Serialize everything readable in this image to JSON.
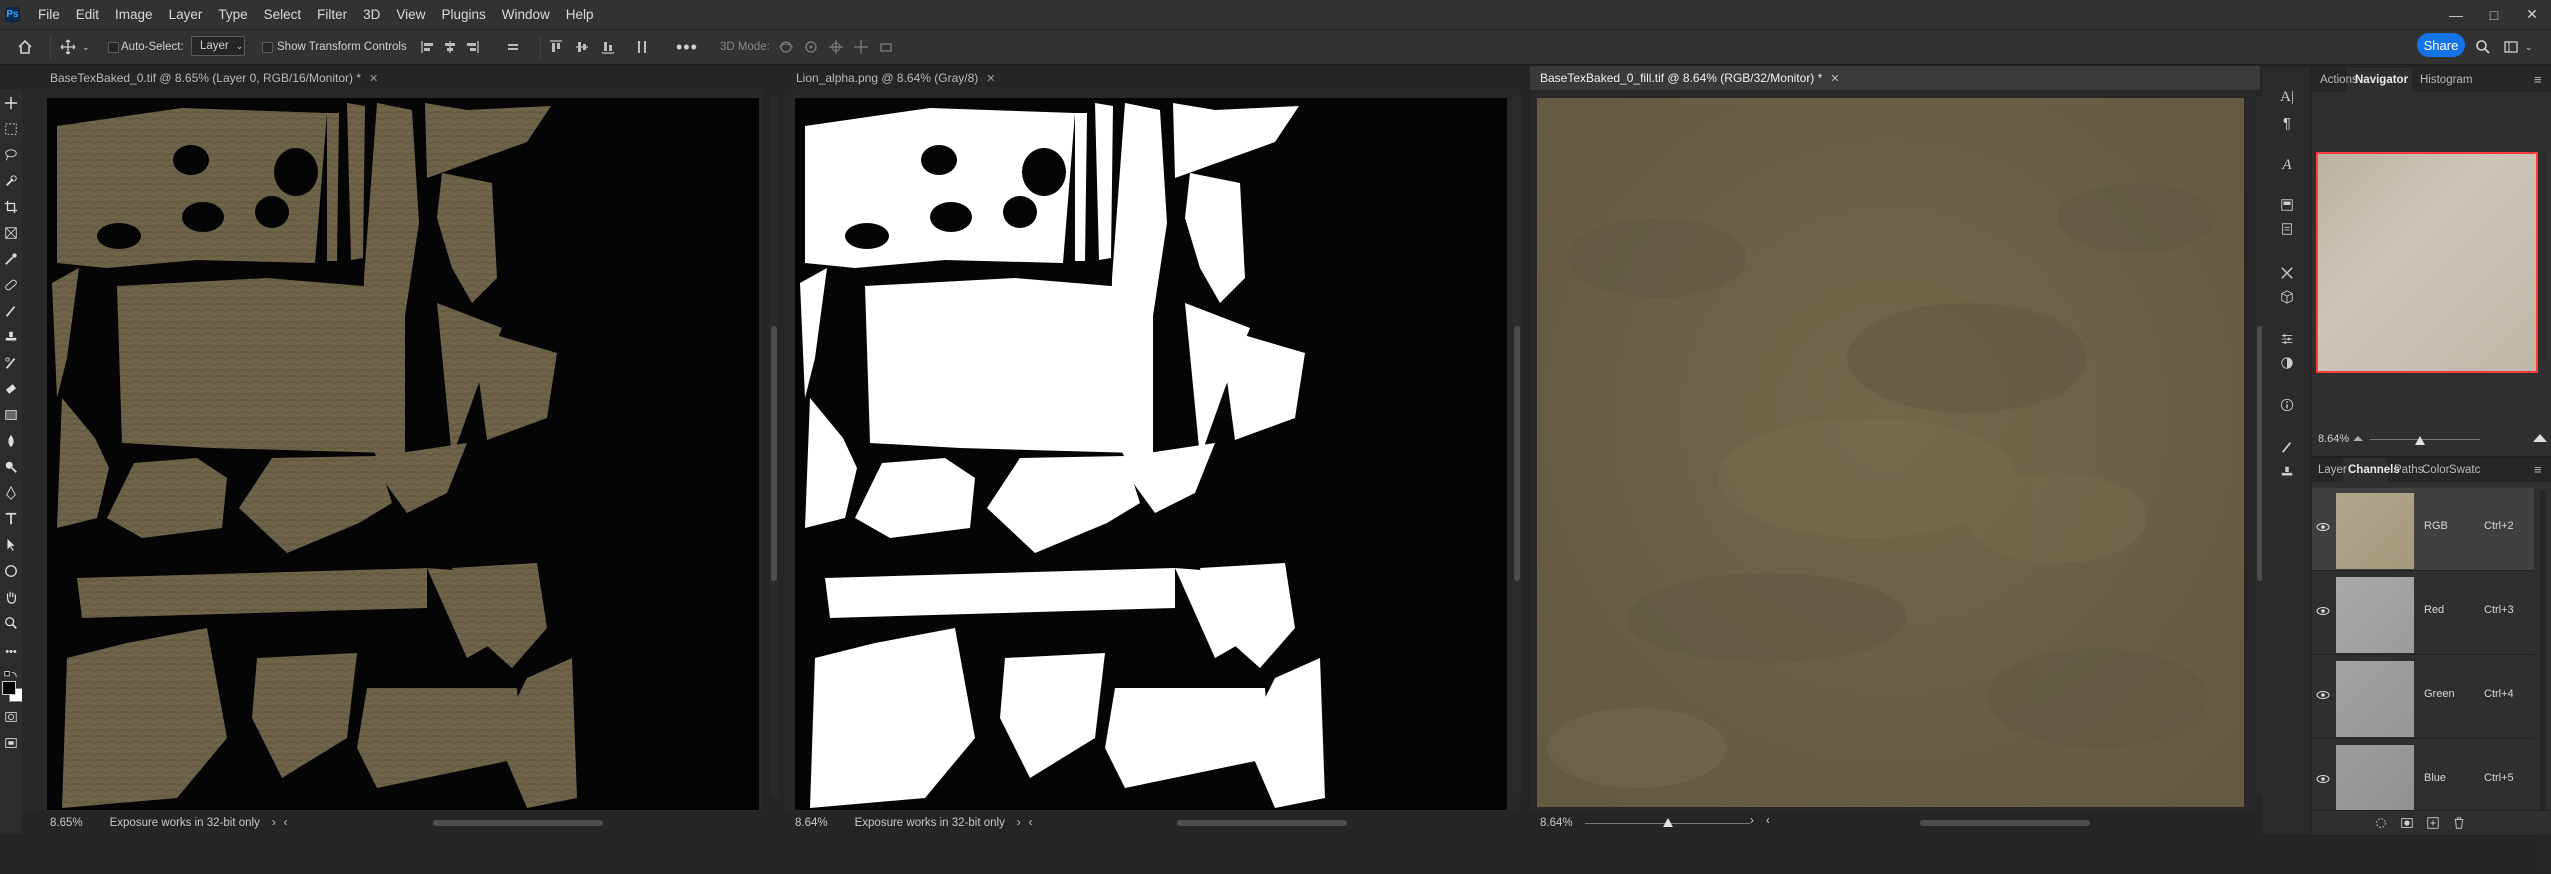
{
  "menubar": {
    "logo": "Ps",
    "items": [
      "File",
      "Edit",
      "Image",
      "Layer",
      "Type",
      "Select",
      "Filter",
      "3D",
      "View",
      "Plugins",
      "Window",
      "Help"
    ]
  },
  "options": {
    "auto_select_label": "Auto-Select:",
    "auto_select_value": "Layer",
    "transform_label": "Show Transform Controls",
    "mode_3d_label": "3D Mode:",
    "share_label": "Share"
  },
  "docs": [
    {
      "tab": "BaseTexBaked_0.tif @ 8.65% (Layer 0, RGB/16/Monitor) *",
      "zoom": "8.65%",
      "status": "Exposure works in 32-bit only"
    },
    {
      "tab": "Lion_alpha.png @ 8.64% (Gray/8)",
      "zoom": "8.64%",
      "status": "Exposure works in 32-bit only"
    },
    {
      "tab": "BaseTexBaked_0_fill.tif @ 8.64% (RGB/32/Monitor) *",
      "zoom": "8.64%",
      "exposure_slider": 0.5
    }
  ],
  "navigator": {
    "tabs": [
      "Actions",
      "Navigator",
      "Histogram"
    ],
    "active": "Navigator",
    "zoom": "8.64%",
    "zoom_slider": 0.45
  },
  "channels_panel": {
    "tabs": [
      "Layer",
      "Channels",
      "Paths",
      "Color",
      "Swatc"
    ],
    "active": "Channels",
    "rows": [
      {
        "name": "RGB",
        "shortcut": "Ctrl+2"
      },
      {
        "name": "Red",
        "shortcut": "Ctrl+3"
      },
      {
        "name": "Green",
        "shortcut": "Ctrl+4"
      },
      {
        "name": "Blue",
        "shortcut": "Ctrl+5"
      }
    ]
  },
  "colors": {
    "texture": "#6f6449",
    "fill": "#6b6247",
    "accent": "#1473e6",
    "nav_frame": "#ff3b3b"
  }
}
